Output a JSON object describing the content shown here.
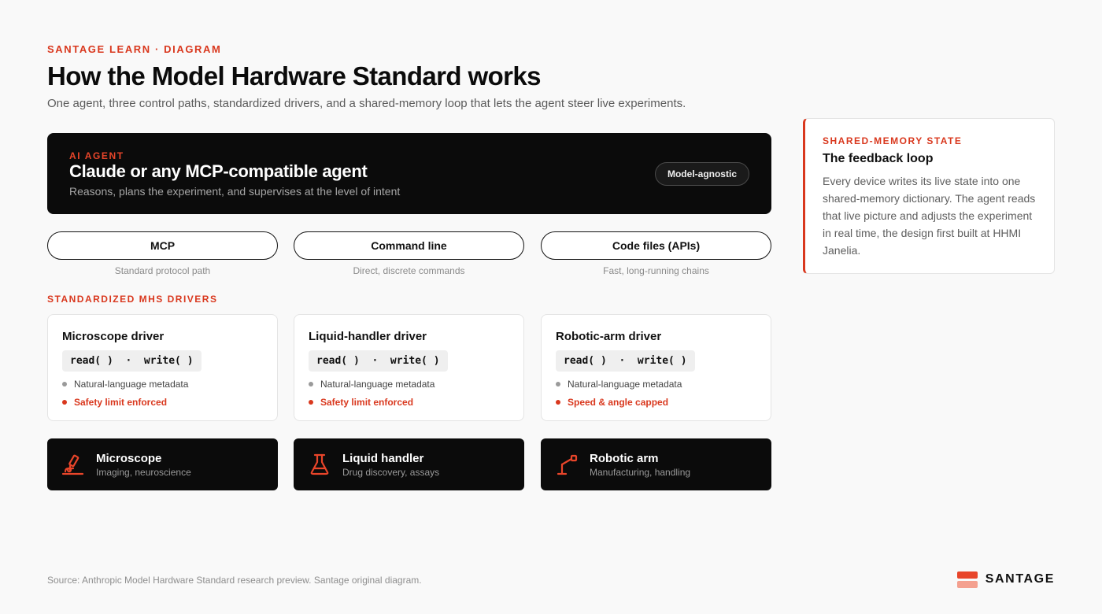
{
  "header": {
    "eyebrow": "SANTAGE LEARN · DIAGRAM",
    "title": "How the Model Hardware Standard works",
    "subtitle": "One agent, three control paths, standardized drivers, and a shared-memory loop that lets the agent steer live experiments."
  },
  "agent": {
    "kicker": "AI AGENT",
    "title": "Claude or any MCP-compatible agent",
    "description": "Reasons, plans the experiment, and supervises at the level of intent",
    "badge": "Model-agnostic"
  },
  "paths": [
    {
      "label": "MCP",
      "caption": "Standard protocol path"
    },
    {
      "label": "Command line",
      "caption": "Direct, discrete commands"
    },
    {
      "label": "Code files (APIs)",
      "caption": "Fast, long-running chains"
    }
  ],
  "drivers_label": "STANDARDIZED MHS DRIVERS",
  "drivers": [
    {
      "title": "Microscope driver",
      "code": "read( )  ·  write( )",
      "meta": "Natural-language metadata",
      "limit": "Safety limit enforced"
    },
    {
      "title": "Liquid-handler driver",
      "code": "read( )  ·  write( )",
      "meta": "Natural-language metadata",
      "limit": "Safety limit enforced"
    },
    {
      "title": "Robotic-arm driver",
      "code": "read( )  ·  write( )",
      "meta": "Natural-language metadata",
      "limit": "Speed & angle capped"
    }
  ],
  "devices": [
    {
      "name": "Microscope",
      "sub": "Imaging, neuroscience",
      "icon": "microscope-icon"
    },
    {
      "name": "Liquid handler",
      "sub": "Drug discovery, assays",
      "icon": "flask-icon"
    },
    {
      "name": "Robotic arm",
      "sub": "Manufacturing, handling",
      "icon": "robotic-arm-icon"
    }
  ],
  "side": {
    "kicker": "SHARED-MEMORY STATE",
    "title": "The feedback loop",
    "body": "Every device writes its live state into one shared-memory dictionary. The agent reads that live picture and adjusts the experiment in real time, the design first built at HHMI Janelia."
  },
  "footer": {
    "source": "Source: Anthropic Model Hardware Standard research preview. Santage original diagram.",
    "brand": "SANTAGE"
  },
  "colors": {
    "accent": "#d9381e",
    "dark": "#0b0b0b",
    "background": "#f9f9f9"
  }
}
